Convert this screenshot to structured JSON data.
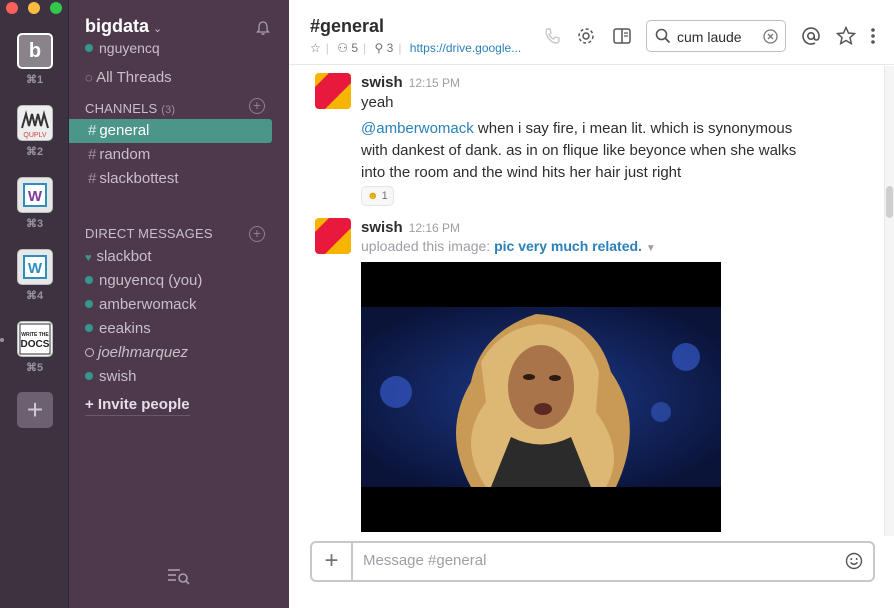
{
  "window": {
    "traffic_lights": [
      "#fc605c",
      "#fdbc40",
      "#34c84a"
    ]
  },
  "teams": [
    {
      "initial": "b",
      "shortcut": "⌘1",
      "active": true
    },
    {
      "label": "QUPLV",
      "shortcut": "⌘2"
    },
    {
      "label": "W",
      "shortcut": "⌘3"
    },
    {
      "label": "W",
      "shortcut": "⌘4"
    },
    {
      "label": "WRITE THE DOCS",
      "shortcut": "⌘5"
    }
  ],
  "sidebar": {
    "team_name": "bigdata",
    "current_user": "nguyencq",
    "all_threads": "All Threads",
    "channels_header": "CHANNELS",
    "channels_count": "(3)",
    "channels": [
      {
        "name": "general",
        "active": true
      },
      {
        "name": "random"
      },
      {
        "name": "slackbottest"
      }
    ],
    "dm_header": "DIRECT MESSAGES",
    "dms": [
      {
        "name": "slackbot",
        "status": "heart"
      },
      {
        "name": "nguyencq (you)",
        "status": "online"
      },
      {
        "name": "amberwomack",
        "status": "online"
      },
      {
        "name": "eeakins",
        "status": "online"
      },
      {
        "name": "joelhmarquez",
        "status": "away"
      },
      {
        "name": "swish",
        "status": "online"
      }
    ],
    "invite": "+ Invite people",
    "colors": {
      "bg": "#4d394b",
      "active": "#4c9689",
      "presence": "#38978d"
    }
  },
  "header": {
    "channel": "#general",
    "members": "5",
    "pinned": "3",
    "topic_link": "https://drive.google...",
    "search_value": "cum laude"
  },
  "messages": [
    {
      "author": "swish",
      "time": "12:15 PM",
      "text": "yeah",
      "mention": "@amberwomack",
      "text2": " when i say fire, i mean lit. which is synonymous with dankest of dank. as in on flique like beyonce when she walks into the room and the wind hits her hair just right",
      "reaction_count": "1"
    },
    {
      "author": "swish",
      "time": "12:16 PM",
      "upload_prefix": "uploaded this image:",
      "file_name": "pic very much related."
    }
  ],
  "composer": {
    "placeholder": "Message #general"
  }
}
